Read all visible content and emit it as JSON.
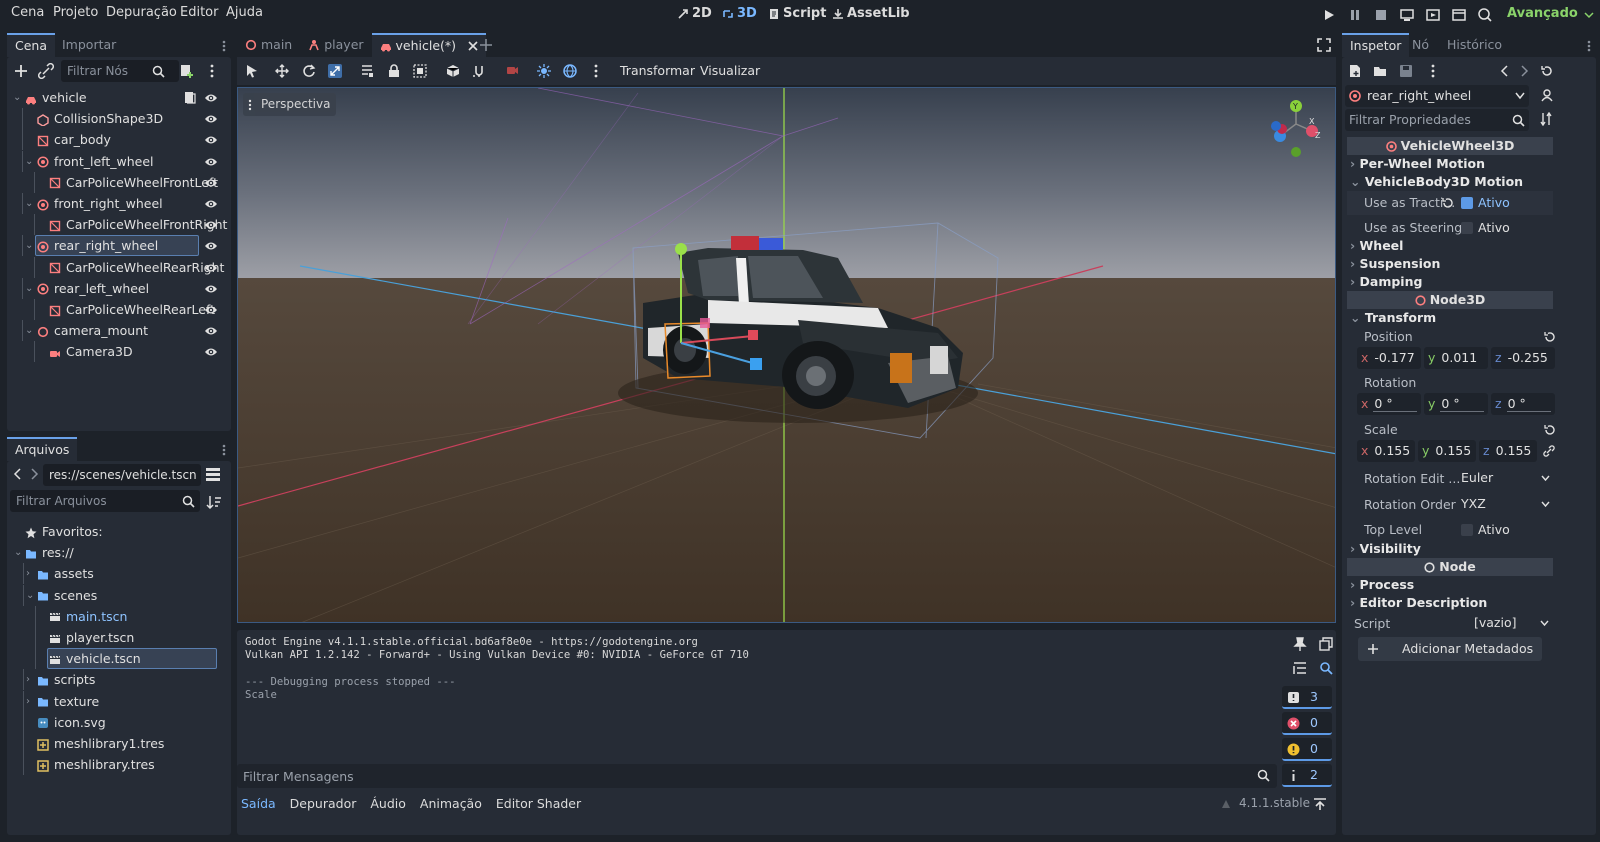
{
  "menu": [
    "Cena",
    "Projeto",
    "Depuração",
    "Editor",
    "Ajuda"
  ],
  "workspaces": {
    "w2d": "2D",
    "w3d": "3D",
    "script": "Script",
    "assetlib": "AssetLib"
  },
  "renderer": "Avançado",
  "scene_dock": {
    "tabs": [
      "Cena",
      "Importar"
    ],
    "filter_placeholder": "Filtrar Nós",
    "tree": [
      {
        "label": "vehicle",
        "depth": 0,
        "icon": "vehicle-body-icon",
        "arrow": true,
        "script": true
      },
      {
        "label": "CollisionShape3D",
        "depth": 1,
        "icon": "collision-shape-icon"
      },
      {
        "label": "car_body",
        "depth": 1,
        "icon": "mesh-instance-icon"
      },
      {
        "label": "front_left_wheel",
        "depth": 1,
        "icon": "vehicle-wheel-icon",
        "arrow": true
      },
      {
        "label": "CarPoliceWheelFrontLeft",
        "depth": 2,
        "icon": "mesh-instance-icon"
      },
      {
        "label": "front_right_wheel",
        "depth": 1,
        "icon": "vehicle-wheel-icon",
        "arrow": true
      },
      {
        "label": "CarPoliceWheelFrontRight",
        "depth": 2,
        "icon": "mesh-instance-icon"
      },
      {
        "label": "rear_right_wheel",
        "depth": 1,
        "icon": "vehicle-wheel-icon",
        "arrow": true,
        "selected": true
      },
      {
        "label": "CarPoliceWheelRearRight",
        "depth": 2,
        "icon": "mesh-instance-icon"
      },
      {
        "label": "rear_left_wheel",
        "depth": 1,
        "icon": "vehicle-wheel-icon",
        "arrow": true
      },
      {
        "label": "CarPoliceWheelRearLeft",
        "depth": 2,
        "icon": "mesh-instance-icon"
      },
      {
        "label": "camera_mount",
        "depth": 1,
        "icon": "node3d-icon",
        "arrow": true
      },
      {
        "label": "Camera3D",
        "depth": 2,
        "icon": "camera-icon"
      }
    ]
  },
  "files_dock": {
    "tab": "Arquivos",
    "path": "res://scenes/vehicle.tscn",
    "filter_placeholder": "Filtrar Arquivos",
    "tree": [
      {
        "label": "Favoritos:",
        "depth": 0,
        "icon": "star-icon"
      },
      {
        "label": "res://",
        "depth": 0,
        "icon": "folder-icon",
        "arrow": true
      },
      {
        "label": "assets",
        "depth": 1,
        "icon": "folder-icon",
        "arrow": true
      },
      {
        "label": "scenes",
        "depth": 1,
        "icon": "folder-icon",
        "arrow": true
      },
      {
        "label": "main.tscn",
        "depth": 2,
        "icon": "scene-file-icon",
        "highlight": true
      },
      {
        "label": "player.tscn",
        "depth": 2,
        "icon": "scene-file-icon"
      },
      {
        "label": "vehicle.tscn",
        "depth": 2,
        "icon": "scene-file-icon",
        "selected": true
      },
      {
        "label": "scripts",
        "depth": 1,
        "icon": "folder-icon",
        "arrow": true
      },
      {
        "label": "texture",
        "depth": 1,
        "icon": "folder-icon",
        "arrow": true
      },
      {
        "label": "icon.svg",
        "depth": 1,
        "icon": "svg-file-icon"
      },
      {
        "label": "meshlibrary1.tres",
        "depth": 1,
        "icon": "resource-file-icon"
      },
      {
        "label": "meshlibrary.tres",
        "depth": 1,
        "icon": "resource-file-icon"
      }
    ]
  },
  "editor_tabs": [
    {
      "label": "main",
      "icon": "node3d-icon"
    },
    {
      "label": "player",
      "icon": "character-icon"
    },
    {
      "label": "vehicle(*)",
      "icon": "vehicle-body-icon",
      "active": true
    }
  ],
  "toolbar": {
    "transform": "Transformar",
    "view": "Visualizar"
  },
  "viewport": {
    "perspective": "Perspectiva",
    "gizmo_axes": [
      "Y",
      "X",
      "Z"
    ]
  },
  "output": {
    "lines": [
      "Godot Engine v4.1.1.stable.official.bd6af8e0e - https://godotengine.org",
      "Vulkan API 1.2.142 - Forward+ - Using Vulkan Device #0: NVIDIA - GeForce GT 710",
      "",
      "--- Debugging process stopped ---",
      "Scale"
    ],
    "filter_placeholder": "Filtrar Mensagens",
    "counts": {
      "messages": "3",
      "errors": "0",
      "warnings": "0",
      "info": "2"
    }
  },
  "bottom_tabs": [
    "Saída",
    "Depurador",
    "Áudio",
    "Animação",
    "Editor Shader"
  ],
  "version": "4.1.1.stable",
  "inspector": {
    "tabs": [
      "Inspetor",
      "Nó",
      "Histórico"
    ],
    "node": "rear_right_wheel",
    "filter_placeholder": "Filtrar Propriedades",
    "class1": "VehicleWheel3D",
    "per_wheel": "Per-Wheel Motion",
    "vehicle_motion": "VehicleBody3D Motion",
    "traction_label": "Use as Tracti...",
    "traction_value": "Ativo",
    "steering_label": "Use as Steering",
    "steering_value": "Ativo",
    "wheel": "Wheel",
    "suspension": "Suspension",
    "damping": "Damping",
    "class2": "Node3D",
    "transform": "Transform",
    "position_label": "Position",
    "position": {
      "x": "-0.177",
      "y": "0.011",
      "z": "-0.255"
    },
    "rotation_label": "Rotation",
    "rotation": {
      "x": "0 °",
      "y": "0 °",
      "z": "0 °"
    },
    "scale_label": "Scale",
    "scale": {
      "x": "0.155",
      "y": "0.155",
      "z": "0.155"
    },
    "rot_edit_label": "Rotation Edit ...",
    "rot_edit_value": "Euler",
    "rot_order_label": "Rotation Order",
    "rot_order_value": "YXZ",
    "top_level_label": "Top Level",
    "top_level_value": "Ativo",
    "visibility": "Visibility",
    "class3": "Node",
    "process": "Process",
    "editor_desc": "Editor Description",
    "script_label": "Script",
    "script_value": "[vazio]",
    "add_meta": "Adicionar Metadados"
  },
  "colors": {
    "accent": "#6aa1e8",
    "bg": "#1d2229",
    "panel": "#262c36",
    "renderer": "#8ad36a"
  }
}
